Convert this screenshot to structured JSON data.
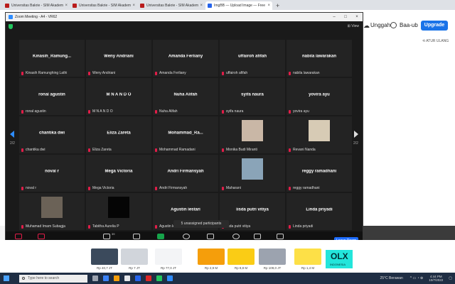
{
  "browser": {
    "tabs": [
      {
        "title": "Universitas Bakrie - SIM Akadem",
        "color": "#b91c1c",
        "active": false
      },
      {
        "title": "Universitas Bakrie - SIM Akadem",
        "color": "#b91c1c",
        "active": false
      },
      {
        "title": "Universitas Bakrie - SIM Akadem",
        "color": "#b91c1c",
        "active": false
      },
      {
        "title": "ImgBB — Upload Image — Free",
        "color": "#2563eb",
        "active": true
      }
    ],
    "close_glyph": "×",
    "new_tab_glyph": "+"
  },
  "site": {
    "upload_label": "Unggah",
    "user_label": "Baa-ub",
    "upgrade_label": "Upgrade",
    "reset_label": "⟲ ATUR ULANG"
  },
  "zoom": {
    "title": "Zoom Meeting - A4 - VR62",
    "view_label": "⊞ View",
    "page_left": "2/2",
    "page_right": "2/2",
    "tooltip": "5 unassigned participants",
    "participants": [
      {
        "display": "Kinasih_Ramung...",
        "label": "Kinasih Ramunghing Lathi"
      },
      {
        "display": "Weny Andriani",
        "label": "Weny Andriani"
      },
      {
        "display": "Amanda Ferliany",
        "label": "Amanda Ferliany"
      },
      {
        "display": "uffairoh afifah",
        "label": "uffairoh afifah"
      },
      {
        "display": "nabila lawarakan",
        "label": "nabila lawarakan"
      },
      {
        "display": "ronal agustin",
        "label": "ronal agustin"
      },
      {
        "display": "M   N A N D O",
        "label": "M   N A N D O"
      },
      {
        "display": "Nuha Alifah",
        "label": "Nuha Alifah"
      },
      {
        "display": "syifa naura",
        "label": "syifa naura"
      },
      {
        "display": "yovira ayu",
        "label": "yovira ayu"
      },
      {
        "display": "chantika dwi",
        "label": "chantika dwi"
      },
      {
        "display": "Eliza Zareta",
        "label": "Eliza Zareta"
      },
      {
        "display": "Mohammad_Ra...",
        "label": "Mohammad Ramadani"
      },
      {
        "display": "",
        "label": "Monika Budi Miranti",
        "photo": "#c9b7a6"
      },
      {
        "display": "",
        "label": "Revani Nanda",
        "photo": "#d7cbb5"
      },
      {
        "display": "noval r",
        "label": "noval r"
      },
      {
        "display": "Mega Victoria",
        "label": "Mega Victoria"
      },
      {
        "display": "Andri Firmansyah",
        "label": "Andri Firmansyah"
      },
      {
        "display": "",
        "label": "Maharani",
        "photo": "#8aa4b8"
      },
      {
        "display": "reggy ramadhani",
        "label": "reggy ramadhani"
      },
      {
        "display": "",
        "label": "Muhamad Imam Subagja",
        "photo": "#6b6257"
      },
      {
        "display": "",
        "label": "Tabitha Aurelia P",
        "photo": "#050505"
      },
      {
        "display": "Agustin lestari",
        "label": "Agustin lestari"
      },
      {
        "display": "lisda putri vitiya",
        "label": "lisda putri vitiya"
      },
      {
        "display": "Linda priyadi",
        "label": "Linda priyadi"
      }
    ],
    "toolbar": {
      "unmute": "Unmute",
      "start_video": "Start Video",
      "participants": "Participants",
      "participants_count": "39",
      "chat": "Chat",
      "share": "Share Screen",
      "record": "Record",
      "breakout": "Breakout Rooms",
      "reactions": "Reactions",
      "apps": "Apps",
      "whiteboards": "Whiteboards",
      "leave": "Leave Room"
    }
  },
  "ads": {
    "cars": [
      {
        "price": "Rp 40,7 JT",
        "color": "#3b4a5c"
      },
      {
        "price": "Rp 7 JT",
        "color": "#d1d5db"
      },
      {
        "price": "Rp 77,0 JT",
        "color": "#f3f4f6"
      },
      {
        "price": "Rp 2,9 M",
        "color": "#f59e0b"
      },
      {
        "price": "Rp 8,8 M",
        "color": "#facc15"
      },
      {
        "price": "Rp 109,0 JT",
        "color": "#9ca3af"
      },
      {
        "price": "Rp 1,4 M",
        "color": "#fde047"
      }
    ],
    "olx_logo": "OLX",
    "olx_sub": "INDONESIA"
  },
  "taskbar": {
    "search_placeholder": "Type here to search",
    "weather": "25°C  Berawan",
    "clock_time": "4:44 PM",
    "clock_date": "10/7/2022"
  }
}
